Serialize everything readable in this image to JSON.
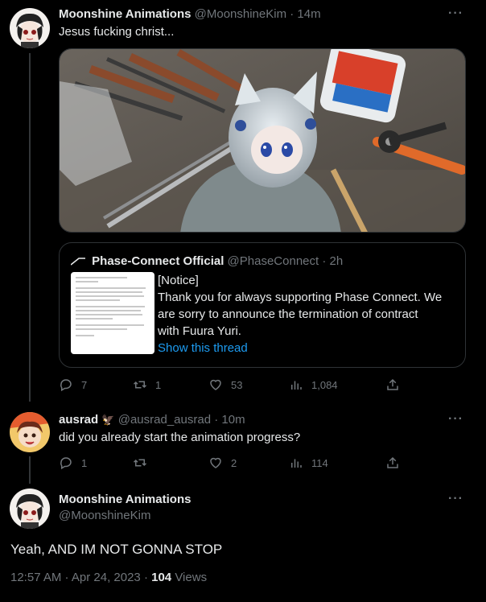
{
  "tweet1": {
    "display_name": "Moonshine Animations",
    "handle": "@MoonshineKim",
    "time": "14m",
    "text": "Jesus fucking christ...",
    "media_icon": "figure-photo",
    "quote": {
      "display_name": "Phase-Connect Official",
      "handle": "@PhaseConnect",
      "time": "2h",
      "body_lines": [
        "[Notice]",
        "Thank you for always supporting Phase Connect. We",
        "are sorry to announce the termination of contract",
        "with Fuura Yuri."
      ],
      "link": "Show this thread"
    },
    "actions": {
      "replies": "7",
      "retweets": "1",
      "likes": "53",
      "views": "1,084"
    }
  },
  "tweet2": {
    "display_name": "ausrad",
    "verified_emoji": "🦅",
    "handle": "@ausrad_ausrad",
    "time": "10m",
    "text": "did you already start the animation progress?",
    "actions": {
      "replies": "1",
      "retweets": "",
      "likes": "2",
      "views": "114"
    }
  },
  "tweet3": {
    "display_name": "Moonshine Animations",
    "handle": "@MoonshineKim",
    "text": "Yeah, AND IM NOT GONNA STOP",
    "timestamp": "12:57 AM · Apr 24, 2023 ·",
    "views_count": "104",
    "views_label": "Views"
  },
  "more_glyph": "···",
  "colors": {
    "accent": "#1d9bf0",
    "muted": "#71767b",
    "text": "#e7e9ea",
    "border": "#2f3336"
  }
}
